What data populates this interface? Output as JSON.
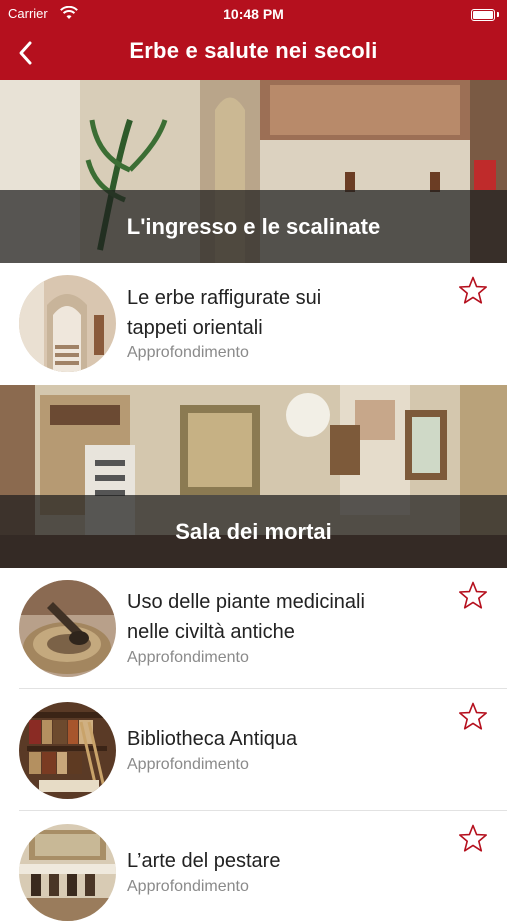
{
  "status_bar": {
    "carrier": "Carrier",
    "time": "10:48 PM"
  },
  "nav": {
    "title": "Erbe e salute nei secoli",
    "back_icon": "chevron-left-icon"
  },
  "colors": {
    "brand_red": "#b5101e",
    "star_outline": "#b5101e"
  },
  "sections": [
    {
      "title": "L'ingresso e le scalinate",
      "items": [
        {
          "title_lines": [
            "Le erbe raffigurate sui",
            "tappeti orientali"
          ],
          "subtitle": "Approfondimento",
          "favorite": false
        }
      ]
    },
    {
      "title": "Sala dei mortai",
      "items": [
        {
          "title_lines": [
            "Uso delle piante medicinali",
            "nelle civiltà antiche"
          ],
          "subtitle": "Approfondimento",
          "favorite": false
        },
        {
          "title_lines": [
            "Bibliotheca Antiqua"
          ],
          "subtitle": "Approfondimento",
          "favorite": false
        },
        {
          "title_lines": [
            "L’arte del pestare"
          ],
          "subtitle": "Approfondimento",
          "favorite": false
        }
      ]
    }
  ]
}
